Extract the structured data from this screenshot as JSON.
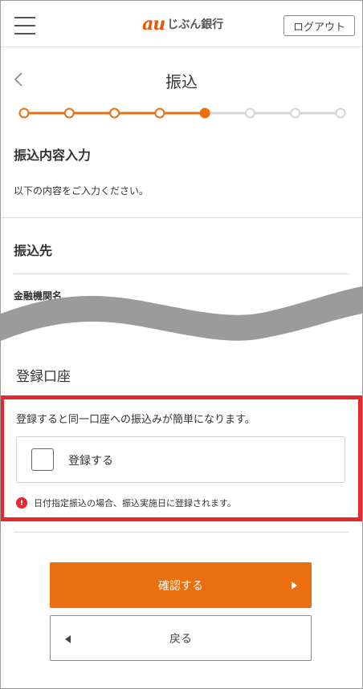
{
  "header": {
    "logo_mark": "au",
    "logo_text": "じぶん銀行",
    "logout_label": "ログアウト",
    "brand_color": "#eb5505"
  },
  "page": {
    "title": "振込"
  },
  "progress": {
    "total_steps": 8,
    "current_step": 5,
    "active_color": "#eb6f0f",
    "inactive_color": "#d5d5d5"
  },
  "input_section": {
    "heading": "振込内容入力",
    "description": "以下の内容をご入力ください。"
  },
  "recipient_section": {
    "heading": "振込先",
    "bank_name_label": "金融機関名"
  },
  "register_section": {
    "heading": "登録口座",
    "description": "登録すると同一口座への振込みが簡単になります。",
    "checkbox_label": "登録する",
    "checked": false,
    "notice_icon": "!",
    "notice_text": "日付指定振込の場合、振込実施日に登録されます。",
    "highlight_color": "#e8262d"
  },
  "actions": {
    "confirm_label": "確認する",
    "back_label": "戻る"
  }
}
